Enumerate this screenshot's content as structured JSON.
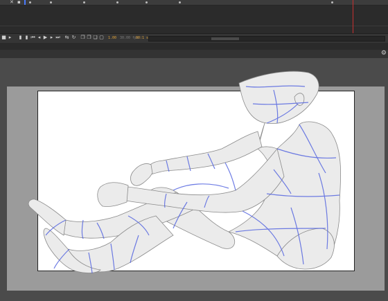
{
  "timeline": {
    "icons": [
      "close-icon",
      "lock-icon",
      "eye-icon"
    ],
    "playhead_color": "#c62f2f",
    "current_frame_color": "#4a7bff"
  },
  "controls": {
    "current_frame": "1.00",
    "fps": "30.00 fps",
    "elapsed": "00:1 s",
    "buttons": [
      "camera-icon",
      "step-back-icon",
      "first-frame-icon",
      "prev-frame-icon",
      "play-icon",
      "next-frame-icon",
      "last-frame-icon",
      "loop-icon",
      "center-frame-icon",
      "onion-skin-icon",
      "onion-skin-outline-icon",
      "edit-multiple-frames-icon",
      "onion-markers-icon"
    ]
  },
  "colors": {
    "stage": "#ffffff",
    "gray_area": "#9b9b9b",
    "grid_lines": "#5566e0",
    "figure": "#e9e9e9"
  }
}
